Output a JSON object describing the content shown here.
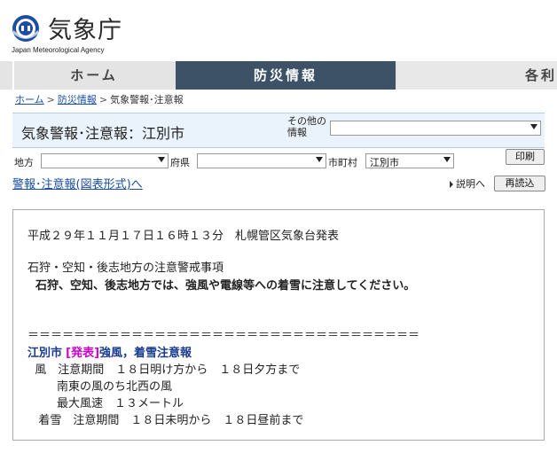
{
  "header": {
    "title": "気象庁",
    "subtitle": "Japan Meteorological Agency"
  },
  "nav": {
    "home": "ホーム",
    "bosai": "防災情報",
    "more": "各利"
  },
  "breadcrumb": {
    "home": "ホーム",
    "bosai": "防災情報",
    "current": "気象警報･注意報"
  },
  "title_box": {
    "title": "気象警報･注意報：江別市",
    "other_label": "その他の情報",
    "other_value": ""
  },
  "filters": {
    "region_label": "地方",
    "region_value": "",
    "pref_label": "府県",
    "pref_value": "",
    "city_label": "市町村",
    "city_value": "江別市"
  },
  "buttons": {
    "print": "印刷",
    "reload": "再読込",
    "explain": "説明へ"
  },
  "links": {
    "chart": "警報･注意報(図表形式)へ"
  },
  "content": {
    "issued": "平成２９年１１月１７日１６時１３分　札幌管区気象台発表",
    "notice_title": "石狩・空知・後志地方の注意警戒事項",
    "notice_body": "  石狩、空知、後志地方では、強風や電線等への着雪に注意してください。",
    "separator": "＝＝＝＝＝＝＝＝＝＝＝＝＝＝＝＝＝＝＝＝＝＝＝＝＝＝＝＝＝＝＝＝＝＝",
    "city": "江別市",
    "hassei": "[発表]",
    "warnings": "強風，着雪注意報",
    "wind_line": "  風　注意期間　１８日明け方から　１８日夕方まで",
    "wind_dir": "        南東の風のち北西の風",
    "wind_speed": "        最大風速　１３メートル",
    "snow_line": "   着雪　注意期間　１８日未明から　１８日昼前まで"
  },
  "colors": {
    "nav_active": "#3d5266",
    "link": "#1a4ea3",
    "title_bg": "#eaf3fb",
    "hassei": "#cc00cc",
    "warning": "#1a3d8f"
  }
}
